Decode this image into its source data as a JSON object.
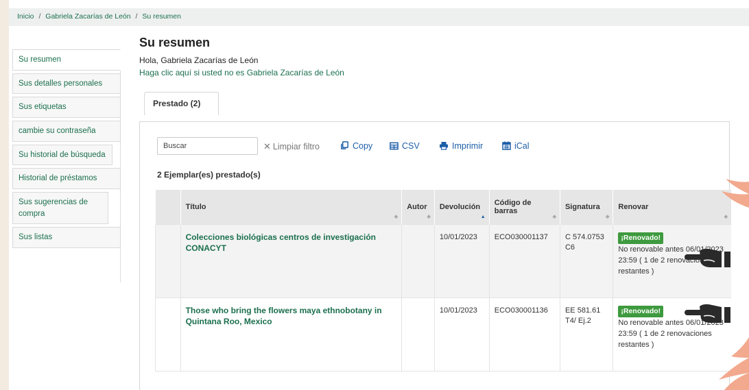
{
  "breadcrumb": {
    "home": "Inicio",
    "user": "Gabriela Zacarías de León",
    "current": "Su resumen",
    "separator": "/"
  },
  "sidebar": {
    "items": [
      {
        "label": "Su resumen",
        "active": true
      },
      {
        "label": "Sus detalles personales"
      },
      {
        "label": "Sus etiquetas"
      },
      {
        "label": "cambie su contraseña"
      },
      {
        "label": "Su historial de búsqueda"
      },
      {
        "label": "Historial de préstamos"
      },
      {
        "label": "Sus sugerencias de compra"
      },
      {
        "label": "Sus listas"
      }
    ]
  },
  "main": {
    "title": "Su resumen",
    "greeting": "Hola, Gabriela Zacarías de León",
    "not_you": "Haga clic aquí si usted no es Gabriela Zacarías de León",
    "tab_label": "Prestado (2)"
  },
  "toolbar": {
    "search_placeholder": "Buscar",
    "clear_filter": "Limpiar filtro",
    "copy": "Copy",
    "csv": "CSV",
    "print": "Imprimir",
    "ical": "iCal"
  },
  "loans": {
    "count_label": "2 Ejemplar(es) prestado(s)",
    "headers": {
      "title": "Título",
      "author": "Autor",
      "due": "Devolución",
      "barcode": "Código de barras",
      "callnumber": "Signatura",
      "renew": "Renovar"
    },
    "rows": [
      {
        "title": "Colecciones biológicas centros de investigación CONACYT",
        "author": "",
        "due": "10/01/2023",
        "barcode": "ECO030001137",
        "callnumber": "C 574.0753 C6",
        "renew_badge": "¡Renovado!",
        "renew_note": "No renovable antes 06/01/2023 23:59 ( 1 de 2 renovaciones restantes )"
      },
      {
        "title": "Those who bring the flowers maya ethnobotany in Quintana Roo, Mexico",
        "author": "",
        "due": "10/01/2023",
        "barcode": "ECO030001136",
        "callnumber": "EE 581.61 T4/ Ej.2",
        "renew_badge": "¡Renovado!",
        "renew_note": "No renovable antes 06/01/2023 23:59 ( 1 de 2 renovaciones restantes )"
      }
    ]
  },
  "colors": {
    "link_green": "#1b6f4e",
    "tool_blue": "#1d5ea8",
    "badge_green": "#3e9a3e",
    "background_beige": "#f3ebe0",
    "decor_peach": "#f2a98e"
  },
  "icons": {
    "copy": "copy-icon",
    "csv": "table-icon",
    "print": "printer-icon",
    "ical": "calendar-icon",
    "clear": "x-icon",
    "pointer": "pointing-hand-icon"
  }
}
